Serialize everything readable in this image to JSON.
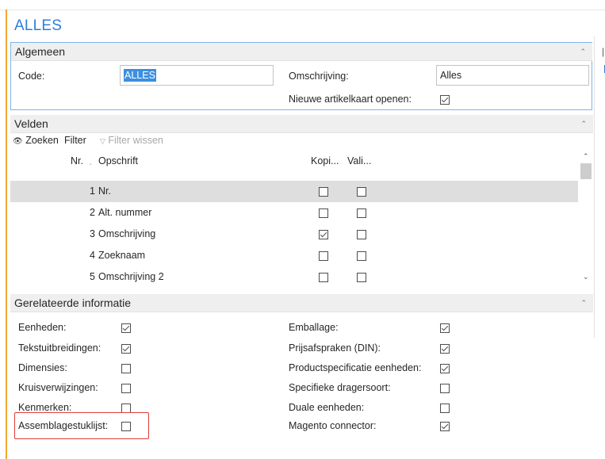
{
  "page": {
    "title": "ALLES"
  },
  "algemeen": {
    "header": "Algemeen",
    "code_label": "Code:",
    "code_value": "ALLES",
    "omschrijving_label": "Omschrijving:",
    "omschrijving_value": "Alles",
    "nieuwe_label": "Nieuwe artikelkaart openen:",
    "nieuwe_checked": true
  },
  "velden": {
    "header": "Velden",
    "toolbar": {
      "zoeken": "Zoeken",
      "filter": "Filter",
      "filter_wissen": "Filter wissen"
    },
    "columns": {
      "nr": "Nr.",
      "opschrift": "Opschrift",
      "kopi": "Kopi...",
      "vali": "Vali..."
    },
    "rows": [
      {
        "nr": "1",
        "opschrift": "Nr.",
        "kopi": false,
        "vali": false,
        "selected": true
      },
      {
        "nr": "2",
        "opschrift": "Alt. nummer",
        "kopi": false,
        "vali": false,
        "selected": false
      },
      {
        "nr": "3",
        "opschrift": "Omschrijving",
        "kopi": true,
        "vali": false,
        "selected": false
      },
      {
        "nr": "4",
        "opschrift": "Zoeknaam",
        "kopi": false,
        "vali": false,
        "selected": false
      },
      {
        "nr": "5",
        "opschrift": "Omschrijving 2",
        "kopi": false,
        "vali": false,
        "selected": false
      }
    ]
  },
  "gerelateerd": {
    "header": "Gerelateerde informatie",
    "left": [
      {
        "label": "Eenheden:",
        "checked": true
      },
      {
        "label": "Tekstuitbreidingen:",
        "checked": true
      },
      {
        "label": "Dimensies:",
        "checked": false
      },
      {
        "label": "Kruisverwijzingen:",
        "checked": false
      },
      {
        "label": "Kenmerken:",
        "checked": false
      },
      {
        "label": "Assemblagestuklijst:",
        "checked": false
      }
    ],
    "right": [
      {
        "label": "Emballage:",
        "checked": true
      },
      {
        "label": "Prijsafspraken (DIN):",
        "checked": true
      },
      {
        "label": "Productspecificatie eenheden:",
        "checked": true
      },
      {
        "label": "Specifieke dragersoort:",
        "checked": false
      },
      {
        "label": "Duale eenheden:",
        "checked": false
      },
      {
        "label": "Magento connector:",
        "checked": true
      }
    ]
  },
  "colors": {
    "accent": "#2e7fd6",
    "selection": "#3b8fe0",
    "highlight": "#e23b3b",
    "sidebar": "#f0a830"
  }
}
